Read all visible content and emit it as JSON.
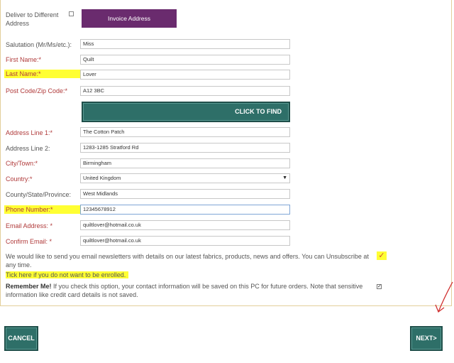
{
  "deliver_different": {
    "label": "Deliver to Different Address"
  },
  "invoice_button": "Invoice Address",
  "fields": {
    "salutation": {
      "label": "Salutation (Mr/Ms/etc.):",
      "value": "Miss"
    },
    "first_name": {
      "label": "First Name:*",
      "value": "Quilt"
    },
    "last_name": {
      "label": "Last Name:*",
      "value": "Lover"
    },
    "postcode": {
      "label": "Post Code/Zip Code:*",
      "value": "A12 3BC"
    },
    "address1": {
      "label": "Address Line 1:*",
      "value": "The Cotton Patch"
    },
    "address2": {
      "label": "Address Line 2:",
      "value": "1283-1285 Stratford Rd"
    },
    "city": {
      "label": "City/Town:*",
      "value": "Birmingham"
    },
    "country": {
      "label": "Country:*",
      "value": "United Kingdom"
    },
    "county": {
      "label": "County/State/Province:",
      "value": "West Midlands"
    },
    "phone": {
      "label": "Phone Number:*",
      "value": "12345678912"
    },
    "email": {
      "label": "Email Address: *",
      "value": "quiltlover@hotmail.co.uk"
    },
    "confirm_email": {
      "label": "Confirm Email: *",
      "value": "quiltlover@hotmail.co.uk"
    }
  },
  "find_button": "CLICK TO FIND",
  "newsletter": {
    "text": "We would like to send you email newsletters with details on our latest fabrics, products, news and offers. You can Unsubscribe at any time.",
    "tick_text": "Tick here if you do not want to be enrolled."
  },
  "remember": {
    "title": "Remember Me!",
    "text": "If you check this option, your contact information will be saved on this PC for future orders. Note that sensitive information like credit card details is not saved."
  },
  "cancel_button": "CANCEL",
  "next_button": "NEXT>",
  "colors": {
    "accent": "#2e6f68",
    "invoice": "#6a2b6e",
    "highlight": "#ffff33",
    "required": "#b03a3a"
  }
}
